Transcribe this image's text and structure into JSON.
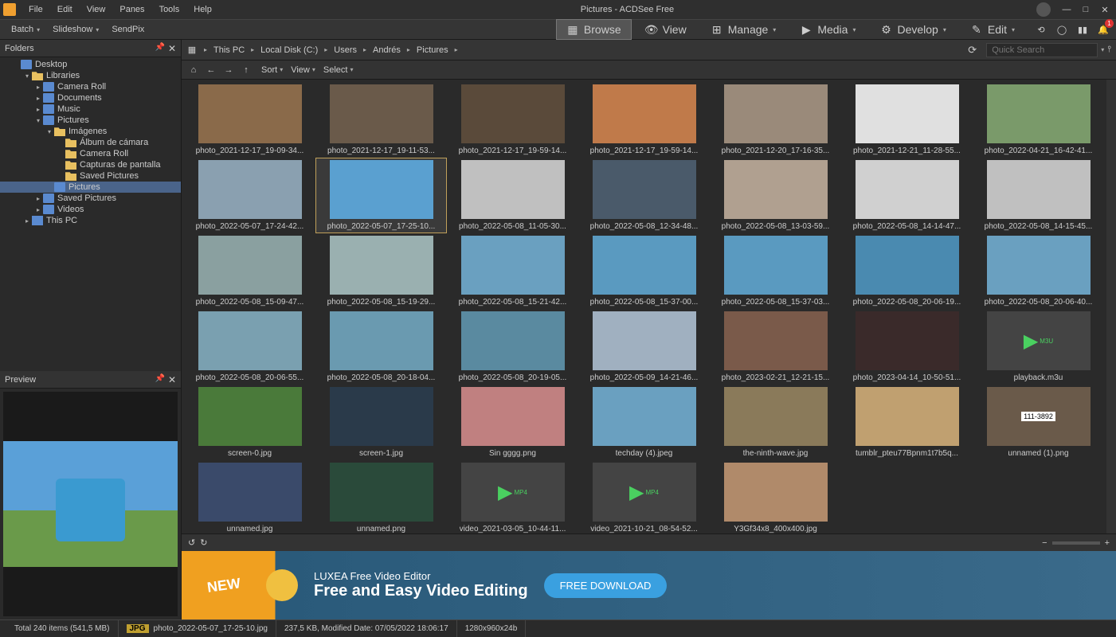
{
  "app": {
    "title": "Pictures - ACDSee Free"
  },
  "menu": [
    "File",
    "Edit",
    "View",
    "Panes",
    "Tools",
    "Help"
  ],
  "toolbar": {
    "batch": "Batch",
    "slideshow": "Slideshow",
    "sendpix": "SendPix"
  },
  "modes": [
    {
      "label": "Browse",
      "active": true
    },
    {
      "label": "View",
      "active": false
    },
    {
      "label": "Manage",
      "active": false
    },
    {
      "label": "Media",
      "active": false
    },
    {
      "label": "Develop",
      "active": false
    },
    {
      "label": "Edit",
      "active": false
    }
  ],
  "notification_badge": "1",
  "folders_panel": {
    "title": "Folders"
  },
  "tree": [
    {
      "indent": 1,
      "tw": "",
      "icon": "blue",
      "label": "Desktop"
    },
    {
      "indent": 2,
      "tw": "▾",
      "icon": "fi",
      "label": "Libraries"
    },
    {
      "indent": 3,
      "tw": "▸",
      "icon": "blue",
      "label": "Camera Roll"
    },
    {
      "indent": 3,
      "tw": "▸",
      "icon": "blue",
      "label": "Documents"
    },
    {
      "indent": 3,
      "tw": "▸",
      "icon": "blue",
      "label": "Music"
    },
    {
      "indent": 3,
      "tw": "▾",
      "icon": "blue",
      "label": "Pictures"
    },
    {
      "indent": 4,
      "tw": "▾",
      "icon": "fi",
      "label": "Imágenes"
    },
    {
      "indent": 5,
      "tw": "",
      "icon": "fi",
      "label": "Álbum de cámara"
    },
    {
      "indent": 5,
      "tw": "",
      "icon": "fi",
      "label": "Camera Roll"
    },
    {
      "indent": 5,
      "tw": "",
      "icon": "fi",
      "label": "Capturas de pantalla"
    },
    {
      "indent": 5,
      "tw": "",
      "icon": "fi",
      "label": "Saved Pictures"
    },
    {
      "indent": 4,
      "tw": "",
      "icon": "blue",
      "label": "Pictures",
      "sel": true
    },
    {
      "indent": 3,
      "tw": "▸",
      "icon": "blue",
      "label": "Saved Pictures"
    },
    {
      "indent": 3,
      "tw": "▸",
      "icon": "blue",
      "label": "Videos"
    },
    {
      "indent": 2,
      "tw": "▸",
      "icon": "pc",
      "label": "This PC"
    }
  ],
  "preview_panel": {
    "title": "Preview"
  },
  "breadcrumb": [
    "This PC",
    "Local Disk (C:)",
    "Users",
    "Andrés",
    "Pictures"
  ],
  "search": {
    "placeholder": "Quick Search"
  },
  "sortbar": {
    "sort": "Sort",
    "view": "View",
    "select": "Select"
  },
  "thumbs": [
    {
      "label": "photo_2021-12-17_19-09-34...",
      "bg": "#8a6a4a"
    },
    {
      "label": "photo_2021-12-17_19-11-53...",
      "bg": "#6a5a4a"
    },
    {
      "label": "photo_2021-12-17_19-59-14...",
      "bg": "#5a4a3a"
    },
    {
      "label": "photo_2021-12-17_19-59-14...",
      "bg": "#c07a4a"
    },
    {
      "label": "photo_2021-12-20_17-16-35...",
      "bg": "#9a8a7a"
    },
    {
      "label": "photo_2021-12-21_11-28-55...",
      "bg": "#e0e0e0"
    },
    {
      "label": "photo_2022-04-21_16-42-41...",
      "bg": "#7a9a6a"
    },
    {
      "label": "photo_2022-05-07_17-24-42...",
      "bg": "#8aa0b0"
    },
    {
      "label": "photo_2022-05-07_17-25-10...",
      "bg": "#5aa0d0",
      "sel": true
    },
    {
      "label": "photo_2022-05-08_11-05-30...",
      "bg": "#c0c0c0"
    },
    {
      "label": "photo_2022-05-08_12-34-48...",
      "bg": "#4a5a6a"
    },
    {
      "label": "photo_2022-05-08_13-03-59...",
      "bg": "#b0a090"
    },
    {
      "label": "photo_2022-05-08_14-14-47...",
      "bg": "#d0d0d0"
    },
    {
      "label": "photo_2022-05-08_14-15-45...",
      "bg": "#c0c0c0"
    },
    {
      "label": "photo_2022-05-08_15-09-47...",
      "bg": "#8aa0a0"
    },
    {
      "label": "photo_2022-05-08_15-19-29...",
      "bg": "#9ab0b0"
    },
    {
      "label": "photo_2022-05-08_15-21-42...",
      "bg": "#6aa0c0"
    },
    {
      "label": "photo_2022-05-08_15-37-00...",
      "bg": "#5a9ac0"
    },
    {
      "label": "photo_2022-05-08_15-37-03...",
      "bg": "#5a9ac0"
    },
    {
      "label": "photo_2022-05-08_20-06-19...",
      "bg": "#4a8ab0"
    },
    {
      "label": "photo_2022-05-08_20-06-40...",
      "bg": "#6aa0c0"
    },
    {
      "label": "photo_2022-05-08_20-06-55...",
      "bg": "#7aa0b0"
    },
    {
      "label": "photo_2022-05-08_20-18-04...",
      "bg": "#6a9ab0"
    },
    {
      "label": "photo_2022-05-08_20-19-05...",
      "bg": "#5a8aa0"
    },
    {
      "label": "photo_2022-05-09_14-21-46...",
      "bg": "#a0b0c0"
    },
    {
      "label": "photo_2023-02-21_12-21-15...",
      "bg": "#7a5a4a"
    },
    {
      "label": "photo_2023-04-14_10-50-51...",
      "bg": "#3a2a2a"
    },
    {
      "label": "playback.m3u",
      "video": true,
      "vlabel": "M3U"
    },
    {
      "label": "screen-0.jpg",
      "bg": "#4a7a3a"
    },
    {
      "label": "screen-1.jpg",
      "bg": "#2a3a4a"
    },
    {
      "label": "Sin gggg.png",
      "bg": "#c08080"
    },
    {
      "label": "techday (4).jpeg",
      "bg": "#6aa0c0"
    },
    {
      "label": "the-ninth-wave.jpg",
      "bg": "#8a7a5a"
    },
    {
      "label": "tumblr_pteu77Bpnm1t7b5q...",
      "bg": "#c0a070"
    },
    {
      "label": "unnamed (1).png",
      "bg": "#6a5a4a",
      "text": "111-3892"
    },
    {
      "label": "unnamed.jpg",
      "bg": "#3a4a6a"
    },
    {
      "label": "unnamed.png",
      "bg": "#2a4a3a"
    },
    {
      "label": "video_2021-03-05_10-44-11...",
      "video": true,
      "vlabel": "MP4"
    },
    {
      "label": "video_2021-10-21_08-54-52...",
      "video": true,
      "vlabel": "MP4"
    },
    {
      "label": "Y3Gf34x8_400x400.jpg",
      "bg": "#b08a6a"
    }
  ],
  "ad": {
    "new": "NEW",
    "title": "LUXEA Free Video Editor",
    "sub": "Free and Easy Video Editing",
    "btn": "FREE DOWNLOAD"
  },
  "status": {
    "total": "Total 240 items  (541,5 MB)",
    "badge": "JPG",
    "filename": "photo_2022-05-07_17-25-10.jpg",
    "meta": "237,5 KB, Modified Date: 07/05/2022 18:06:17",
    "dims": "1280x960x24b"
  }
}
